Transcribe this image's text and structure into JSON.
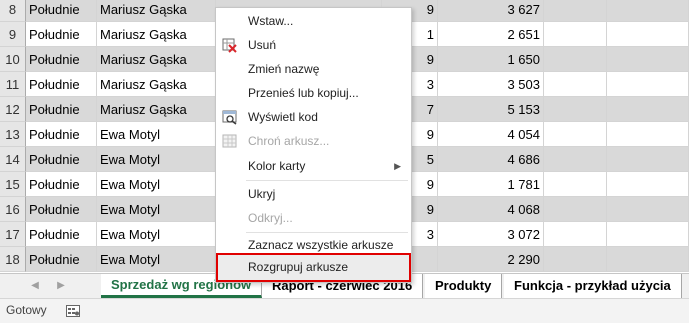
{
  "rows": [
    {
      "num": "8",
      "region": "Południe",
      "name": "Mariusz Gąska",
      "col4": "9",
      "value": "3 627",
      "shaded": true
    },
    {
      "num": "9",
      "region": "Południe",
      "name": "Mariusz Gąska",
      "col4": "1",
      "value": "2 651",
      "shaded": false
    },
    {
      "num": "10",
      "region": "Południe",
      "name": "Mariusz Gąska",
      "col4": "9",
      "value": "1 650",
      "shaded": true
    },
    {
      "num": "11",
      "region": "Południe",
      "name": "Mariusz Gąska",
      "col4": "3",
      "value": "3 503",
      "shaded": false
    },
    {
      "num": "12",
      "region": "Południe",
      "name": "Mariusz Gąska",
      "col4": "7",
      "value": "5 153",
      "shaded": true
    },
    {
      "num": "13",
      "region": "Południe",
      "name": "Ewa Motyl",
      "col4": "9",
      "value": "4 054",
      "shaded": false
    },
    {
      "num": "14",
      "region": "Południe",
      "name": "Ewa Motyl",
      "col4": "5",
      "value": "4 686",
      "shaded": true
    },
    {
      "num": "15",
      "region": "Południe",
      "name": "Ewa Motyl",
      "col4": "9",
      "value": "1 781",
      "shaded": false
    },
    {
      "num": "16",
      "region": "Południe",
      "name": "Ewa Motyl",
      "col4": "9",
      "value": "4 068",
      "shaded": true
    },
    {
      "num": "17",
      "region": "Południe",
      "name": "Ewa Motyl",
      "col4": "3",
      "value": "3 072",
      "shaded": false
    },
    {
      "num": "18",
      "region": "Południe",
      "name": "Ewa Motyl",
      "col4": "",
      "value": "2 290",
      "shaded": true
    }
  ],
  "context_menu": {
    "items": [
      {
        "label": "Wstaw...",
        "enabled": true,
        "icon": ""
      },
      {
        "label": "Usuń",
        "enabled": true,
        "icon": "delete-sheet-icon"
      },
      {
        "label": "Zmień nazwę",
        "enabled": true,
        "icon": ""
      },
      {
        "label": "Przenieś lub kopiuj...",
        "enabled": true,
        "icon": ""
      },
      {
        "label": "Wyświetl kod",
        "enabled": true,
        "icon": "view-code-icon"
      },
      {
        "label": "Chroń arkusz...",
        "enabled": false,
        "icon": "protect-sheet-icon"
      },
      {
        "label": "Kolor karty",
        "enabled": true,
        "icon": "",
        "submenu": true
      },
      {
        "label": "Ukryj",
        "enabled": true,
        "icon": ""
      },
      {
        "label": "Odkryj...",
        "enabled": false,
        "icon": ""
      },
      {
        "label": "Zaznacz wszystkie arkusze",
        "enabled": true,
        "icon": ""
      },
      {
        "label": "Rozgrupuj arkusze",
        "enabled": true,
        "icon": "",
        "highlighted": true
      }
    ]
  },
  "sheet_tabs": [
    {
      "label": "Sprzedaż wg regionów",
      "active": true
    },
    {
      "label": "Raport - czerwiec 2016",
      "active": false
    },
    {
      "label": "Produkty",
      "active": false
    },
    {
      "label": "Funkcja - przykład użycia",
      "active": false
    }
  ],
  "status": {
    "text": "Gotowy"
  },
  "colors": {
    "active_tab": "#217346",
    "highlight_border": "#e00000",
    "row_shade": "#d9d9d9"
  }
}
